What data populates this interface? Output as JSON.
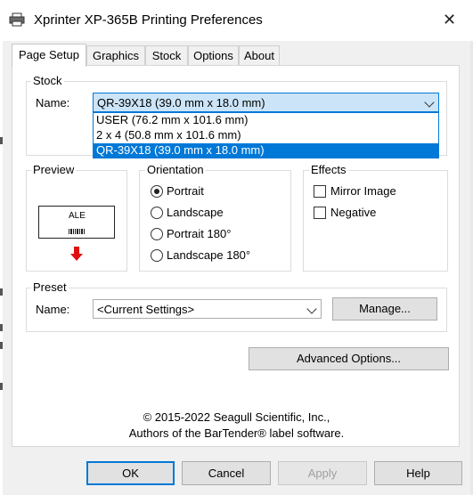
{
  "window": {
    "title": "Xprinter XP-365B Printing Preferences",
    "close_glyph": "✕"
  },
  "tabs": [
    {
      "label": "Page Setup",
      "active": true
    },
    {
      "label": "Graphics",
      "active": false
    },
    {
      "label": "Stock",
      "active": false
    },
    {
      "label": "Options",
      "active": false
    },
    {
      "label": "About",
      "active": false
    }
  ],
  "stock": {
    "group_label": "Stock",
    "name_label": "Name:",
    "selected": "QR-39X18 (39.0 mm x 18.0 mm)",
    "options": [
      {
        "label": "USER (76.2 mm x 101.6 mm)",
        "selected": false
      },
      {
        "label": "2 x 4 (50.8 mm x 101.6 mm)",
        "selected": false
      },
      {
        "label": "QR-39X18 (39.0 mm x 18.0 mm)",
        "selected": true
      }
    ]
  },
  "preview": {
    "group_label": "Preview",
    "sample_text": "ALE",
    "arrow_color": "#e01010"
  },
  "orientation": {
    "group_label": "Orientation",
    "options": [
      {
        "label": "Portrait",
        "checked": true
      },
      {
        "label": "Landscape",
        "checked": false
      },
      {
        "label": "Portrait 180°",
        "checked": false
      },
      {
        "label": "Landscape 180°",
        "checked": false
      }
    ]
  },
  "effects": {
    "group_label": "Effects",
    "options": [
      {
        "label": "Mirror Image",
        "checked": false
      },
      {
        "label": "Negative",
        "checked": false
      }
    ]
  },
  "preset": {
    "group_label": "Preset",
    "name_label": "Name:",
    "selected": "<Current Settings>",
    "manage_label": "Manage..."
  },
  "advanced_label": "Advanced Options...",
  "copyright": {
    "line1": "© 2015-2022 Seagull Scientific, Inc.,",
    "line2": "Authors of the BarTender® label software."
  },
  "buttons": {
    "ok": "OK",
    "cancel": "Cancel",
    "apply": "Apply",
    "help": "Help"
  },
  "colors": {
    "accent": "#0078d7",
    "selection_bg": "#0078d7",
    "focus_bg": "#cce4f7"
  }
}
